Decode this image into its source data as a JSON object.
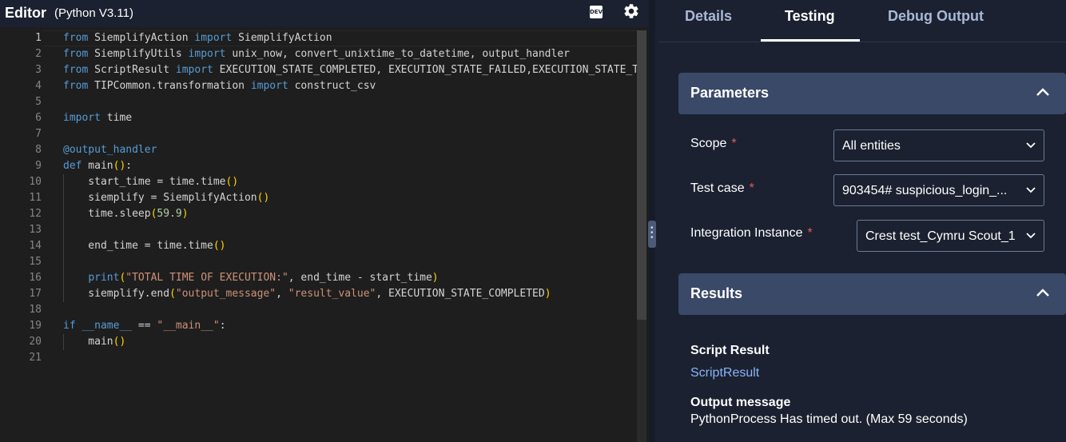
{
  "editor": {
    "title": "Editor",
    "language": "(Python V3.11)",
    "dev_badge": "DEV",
    "icons": [
      "dev-icon",
      "gear-icon"
    ],
    "line_numbers": [
      "1",
      "2",
      "3",
      "4",
      "5",
      "6",
      "7",
      "8",
      "9",
      "10",
      "11",
      "12",
      "13",
      "14",
      "15",
      "16",
      "17",
      "18",
      "19",
      "20",
      "21"
    ],
    "lines": [
      [
        {
          "t": "from",
          "c": "kw"
        },
        {
          "t": " SiemplifyAction ",
          "c": "tx"
        },
        {
          "t": "import",
          "c": "kw"
        },
        {
          "t": " SiemplifyAction",
          "c": "tx"
        }
      ],
      [
        {
          "t": "from",
          "c": "kw"
        },
        {
          "t": " SiemplifyUtils ",
          "c": "tx"
        },
        {
          "t": "import",
          "c": "kw"
        },
        {
          "t": " unix_now, convert_unixtime_to_datetime, output_handler",
          "c": "tx"
        }
      ],
      [
        {
          "t": "from",
          "c": "kw"
        },
        {
          "t": " ScriptResult ",
          "c": "tx"
        },
        {
          "t": "import",
          "c": "kw"
        },
        {
          "t": " EXECUTION_STATE_COMPLETED, EXECUTION_STATE_FAILED,EXECUTION_STATE_TIMEDOUT",
          "c": "tx"
        }
      ],
      [
        {
          "t": "from",
          "c": "kw"
        },
        {
          "t": " TIPCommon.transformation ",
          "c": "tx"
        },
        {
          "t": "import",
          "c": "kw"
        },
        {
          "t": " construct_csv",
          "c": "tx"
        }
      ],
      [],
      [
        {
          "t": "import",
          "c": "kw"
        },
        {
          "t": " time",
          "c": "tx"
        }
      ],
      [],
      [
        {
          "t": "@output_handler",
          "c": "kw"
        }
      ],
      [
        {
          "t": "def",
          "c": "kw"
        },
        {
          "t": " main",
          "c": "tx"
        },
        {
          "t": "()",
          "c": "br"
        },
        {
          "t": ":",
          "c": "tx"
        }
      ],
      [
        {
          "t": "    start_time = time.time",
          "c": "tx"
        },
        {
          "t": "()",
          "c": "br"
        }
      ],
      [
        {
          "t": "    siemplify = SiemplifyAction",
          "c": "tx"
        },
        {
          "t": "()",
          "c": "br"
        }
      ],
      [
        {
          "t": "    time.sleep",
          "c": "tx"
        },
        {
          "t": "(",
          "c": "br"
        },
        {
          "t": "59.9",
          "c": "nm"
        },
        {
          "t": ")",
          "c": "br"
        }
      ],
      [],
      [
        {
          "t": "    end_time = time.time",
          "c": "tx"
        },
        {
          "t": "()",
          "c": "br"
        }
      ],
      [],
      [
        {
          "t": "    ",
          "c": "tx"
        },
        {
          "t": "print",
          "c": "kw"
        },
        {
          "t": "(",
          "c": "br"
        },
        {
          "t": "\"TOTAL TIME OF EXECUTION:\"",
          "c": "st"
        },
        {
          "t": ", end_time - start_time",
          "c": "tx"
        },
        {
          "t": ")",
          "c": "br"
        }
      ],
      [
        {
          "t": "    siemplify.end",
          "c": "tx"
        },
        {
          "t": "(",
          "c": "br"
        },
        {
          "t": "\"output_message\"",
          "c": "st"
        },
        {
          "t": ", ",
          "c": "tx"
        },
        {
          "t": "\"result_value\"",
          "c": "st"
        },
        {
          "t": ", EXECUTION_STATE_COMPLETED",
          "c": "tx"
        },
        {
          "t": ")",
          "c": "br"
        }
      ],
      [],
      [
        {
          "t": "if",
          "c": "kw"
        },
        {
          "t": " ",
          "c": "tx"
        },
        {
          "t": "__name__",
          "c": "kw"
        },
        {
          "t": " == ",
          "c": "tx"
        },
        {
          "t": "\"__main__\"",
          "c": "st"
        },
        {
          "t": ":",
          "c": "tx"
        }
      ],
      [
        {
          "t": "    main",
          "c": "tx"
        },
        {
          "t": "()",
          "c": "br"
        }
      ],
      []
    ],
    "colors": {
      "kw": "#569cd6",
      "tx": "#d4d4d4",
      "st": "#ce9178",
      "br": "#ffd700",
      "nm": "#b5cea8"
    }
  },
  "tabs": [
    {
      "label": "Details",
      "active": false
    },
    {
      "label": "Testing",
      "active": true
    },
    {
      "label": "Debug Output",
      "active": false
    }
  ],
  "parameters": {
    "title": "Parameters",
    "required_mark": "*",
    "fields": [
      {
        "label": "Scope",
        "value": "All entities"
      },
      {
        "label": "Test case",
        "value": "903454# suspicious_login_..."
      },
      {
        "label": "Integration Instance",
        "value": "Crest test_Cymru Scout_1"
      }
    ]
  },
  "results": {
    "title": "Results",
    "script_result_label": "Script Result",
    "script_result_value": "ScriptResult",
    "output_label": "Output message",
    "output_value": "PythonProcess Has timed out. (Max 59 seconds)"
  }
}
